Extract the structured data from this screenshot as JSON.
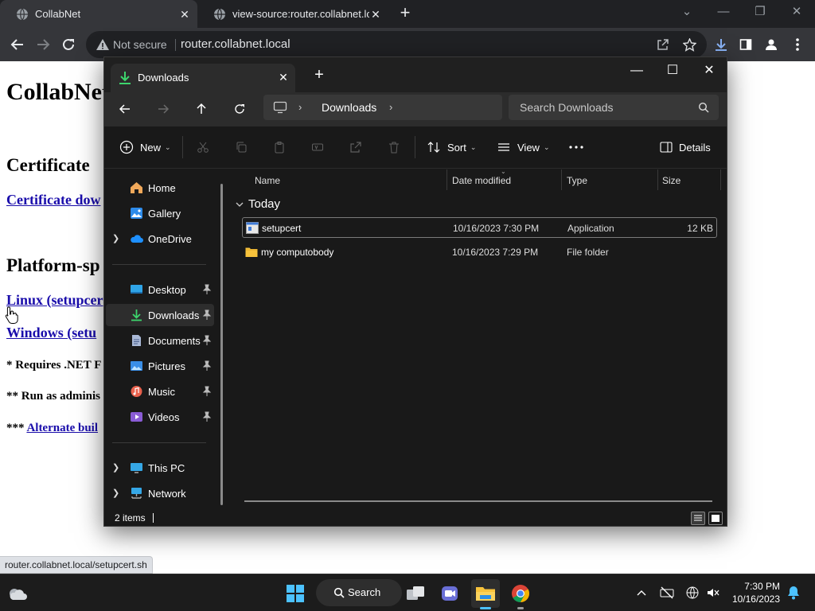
{
  "browser": {
    "tabs": [
      {
        "title": "CollabNet",
        "active": true
      },
      {
        "title": "view-source:router.collabnet.local",
        "active": false
      }
    ],
    "security_label": "Not secure",
    "url": "router.collabnet.local",
    "status_url": "router.collabnet.local/setupcert.sh"
  },
  "webpage": {
    "heading": "CollabNet",
    "section_certificate": "Certificate",
    "link_certificate_download": "Certificate dow",
    "section_platform": "Platform-sp",
    "link_linux": "Linux (setupcer",
    "link_windows": "Windows (setu",
    "note_requires_prefix": "* Requires .NET F",
    "note_run_as_admin": "** Run as adminis",
    "note_alternate_prefix": "*** ",
    "link_alternate": "Alternate buil"
  },
  "explorer": {
    "tab_title": "Downloads",
    "breadcrumb_current": "Downloads",
    "search_placeholder": "Search Downloads",
    "commands": {
      "new": "New",
      "sort": "Sort",
      "view": "View",
      "details": "Details"
    },
    "sidebar": {
      "home": "Home",
      "gallery": "Gallery",
      "onedrive": "OneDrive",
      "desktop": "Desktop",
      "downloads": "Downloads",
      "documents": "Documents",
      "pictures": "Pictures",
      "music": "Music",
      "videos": "Videos",
      "this_pc": "This PC",
      "network": "Network"
    },
    "columns": {
      "name": "Name",
      "date": "Date modified",
      "type": "Type",
      "size": "Size"
    },
    "group_label": "Today",
    "files": [
      {
        "name": "setupcert",
        "date": "10/16/2023 7:30 PM",
        "type": "Application",
        "size": "12 KB"
      },
      {
        "name": "my computobody",
        "date": "10/16/2023 7:29 PM",
        "type": "File folder",
        "size": ""
      }
    ],
    "status": "2 items"
  },
  "taskbar": {
    "search_label": "Search",
    "time": "7:30 PM",
    "date": "10/16/2023"
  },
  "colors": {
    "chrome_dark": "#202124",
    "chrome_toolbar": "#35363a",
    "explorer_bg": "#191919",
    "link_blue": "#1a0dab",
    "accent_blue": "#4cc2ff",
    "download_green": "#3dd56d",
    "folder_yellow": "#f8c33c"
  }
}
